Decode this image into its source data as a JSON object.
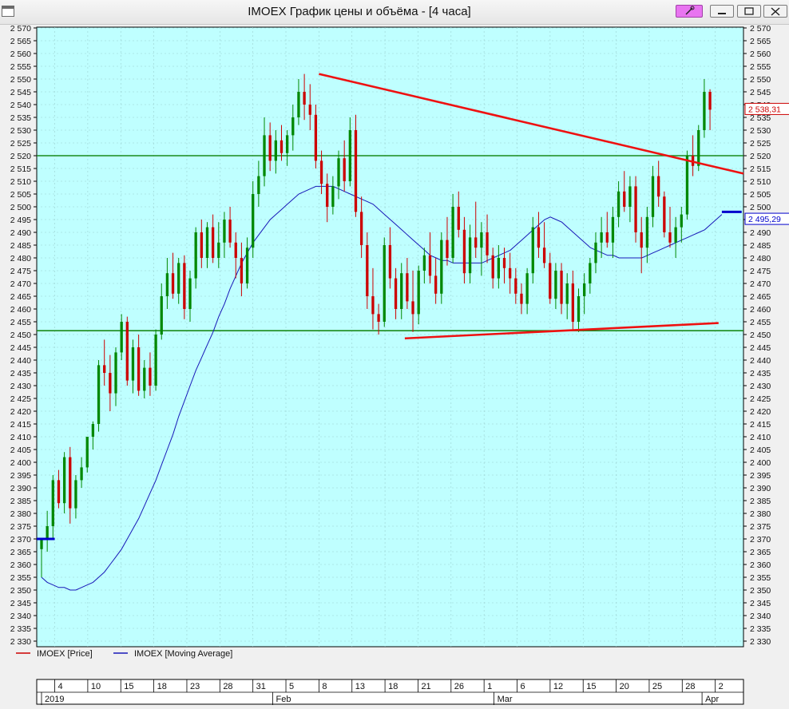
{
  "window": {
    "title": "IMOEX График цены и объёма - [4 часа]",
    "pin_icon": "pin-icon",
    "min_icon": "minimize-icon",
    "max_icon": "maximize-icon",
    "close_icon": "close-icon"
  },
  "legend": {
    "price": "IMOEX [Price]",
    "ma": "IMOEX [Moving Average]"
  },
  "colors": {
    "plot_bg": "#bfffff",
    "bull": "#008800",
    "bear": "#cc0000",
    "ma": "#1818b8",
    "hline": "#1a8a1a",
    "trend": "#ee1111",
    "blue_marker": "#0000cc"
  },
  "chart_data": {
    "type": "candlestick",
    "ylim": [
      2330,
      2572
    ],
    "y_ticks": [
      "2 570",
      "2 565",
      "2 560",
      "2 555",
      "2 550",
      "2 545",
      "2 540",
      "2 535",
      "2 530",
      "2 525",
      "2 520",
      "2 515",
      "2 510",
      "2 505",
      "2 500",
      "2 495",
      "2 490",
      "2 485",
      "2 480",
      "2 475",
      "2 470",
      "2 465",
      "2 460",
      "2 455",
      "2 450",
      "2 445",
      "2 440",
      "2 435",
      "2 430",
      "2 425",
      "2 420",
      "2 415",
      "2 410",
      "2 405",
      "2 400",
      "2 395",
      "2 390",
      "2 385",
      "2 380",
      "2 375",
      "2 370",
      "2 365",
      "2 360",
      "2 355",
      "2 350",
      "2 345",
      "2 340",
      "2 335",
      "2 330"
    ],
    "x_day_labels": [
      "4",
      "10",
      "15",
      "18",
      "23",
      "28",
      "31",
      "5",
      "8",
      "13",
      "18",
      "21",
      "26",
      "1",
      "6",
      "12",
      "15",
      "20",
      "25",
      "28",
      "2"
    ],
    "x_month_labels": [
      "2019",
      "Feb",
      "Mar",
      "Apr"
    ],
    "x_month_tick_idx": [
      0,
      70,
      137,
      200
    ],
    "x_day_tick_idx": [
      4,
      14,
      24,
      34,
      44,
      54,
      64,
      74,
      84,
      94,
      104,
      114,
      124,
      134,
      144,
      154,
      164,
      174,
      184,
      194,
      204
    ],
    "candles": [
      [
        2366,
        2370,
        2355,
        2370
      ],
      [
        2370,
        2381,
        2365,
        2375
      ],
      [
        2375,
        2395,
        2370,
        2393
      ],
      [
        2393,
        2397,
        2382,
        2384
      ],
      [
        2384,
        2404,
        2380,
        2402
      ],
      [
        2402,
        2406,
        2376,
        2382
      ],
      [
        2382,
        2395,
        2378,
        2393
      ],
      [
        2393,
        2402,
        2390,
        2398
      ],
      [
        2398,
        2410,
        2396,
        2410
      ],
      [
        2410,
        2416,
        2405,
        2415
      ],
      [
        2415,
        2440,
        2412,
        2438
      ],
      [
        2438,
        2448,
        2430,
        2435
      ],
      [
        2435,
        2442,
        2420,
        2427
      ],
      [
        2427,
        2445,
        2422,
        2443
      ],
      [
        2443,
        2458,
        2440,
        2455
      ],
      [
        2455,
        2457,
        2430,
        2432
      ],
      [
        2432,
        2448,
        2427,
        2445
      ],
      [
        2445,
        2450,
        2426,
        2428
      ],
      [
        2428,
        2440,
        2425,
        2437
      ],
      [
        2437,
        2443,
        2426,
        2430
      ],
      [
        2430,
        2452,
        2428,
        2450
      ],
      [
        2450,
        2470,
        2448,
        2465
      ],
      [
        2465,
        2480,
        2460,
        2474
      ],
      [
        2474,
        2482,
        2464,
        2466
      ],
      [
        2466,
        2480,
        2462,
        2478
      ],
      [
        2478,
        2481,
        2456,
        2460
      ],
      [
        2460,
        2475,
        2455,
        2472
      ],
      [
        2472,
        2492,
        2468,
        2490
      ],
      [
        2490,
        2495,
        2476,
        2480
      ],
      [
        2480,
        2494,
        2476,
        2492
      ],
      [
        2492,
        2497,
        2478,
        2480
      ],
      [
        2480,
        2494,
        2476,
        2486
      ],
      [
        2486,
        2498,
        2480,
        2495
      ],
      [
        2495,
        2500,
        2484,
        2486
      ],
      [
        2486,
        2490,
        2472,
        2480
      ],
      [
        2480,
        2486,
        2465,
        2470
      ],
      [
        2470,
        2488,
        2468,
        2484
      ],
      [
        2484,
        2510,
        2480,
        2505
      ],
      [
        2505,
        2518,
        2500,
        2512
      ],
      [
        2512,
        2535,
        2508,
        2528
      ],
      [
        2528,
        2533,
        2514,
        2518
      ],
      [
        2518,
        2530,
        2513,
        2526
      ],
      [
        2526,
        2532,
        2518,
        2521
      ],
      [
        2521,
        2530,
        2516,
        2528
      ],
      [
        2528,
        2540,
        2522,
        2535
      ],
      [
        2535,
        2550,
        2532,
        2545
      ],
      [
        2545,
        2552,
        2534,
        2540
      ],
      [
        2540,
        2548,
        2530,
        2536
      ],
      [
        2536,
        2540,
        2515,
        2518
      ],
      [
        2518,
        2522,
        2505,
        2509
      ],
      [
        2509,
        2513,
        2494,
        2500
      ],
      [
        2500,
        2512,
        2497,
        2508
      ],
      [
        2508,
        2522,
        2503,
        2519
      ],
      [
        2519,
        2526,
        2506,
        2510
      ],
      [
        2510,
        2535,
        2508,
        2530
      ],
      [
        2530,
        2536,
        2496,
        2498
      ],
      [
        2498,
        2504,
        2480,
        2485
      ],
      [
        2485,
        2490,
        2460,
        2465
      ],
      [
        2465,
        2476,
        2452,
        2458
      ],
      [
        2458,
        2462,
        2450,
        2455
      ],
      [
        2455,
        2488,
        2453,
        2485
      ],
      [
        2485,
        2492,
        2468,
        2472
      ],
      [
        2472,
        2476,
        2456,
        2460
      ],
      [
        2460,
        2478,
        2456,
        2474
      ],
      [
        2474,
        2480,
        2460,
        2463
      ],
      [
        2463,
        2475,
        2451,
        2458
      ],
      [
        2458,
        2477,
        2454,
        2475
      ],
      [
        2475,
        2484,
        2470,
        2481
      ],
      [
        2481,
        2490,
        2470,
        2473
      ],
      [
        2473,
        2480,
        2462,
        2466
      ],
      [
        2466,
        2490,
        2462,
        2487
      ],
      [
        2487,
        2496,
        2477,
        2480
      ],
      [
        2480,
        2505,
        2478,
        2500
      ],
      [
        2500,
        2506,
        2488,
        2491
      ],
      [
        2491,
        2496,
        2470,
        2474
      ],
      [
        2474,
        2493,
        2470,
        2488
      ],
      [
        2488,
        2502,
        2480,
        2484
      ],
      [
        2484,
        2494,
        2473,
        2490
      ],
      [
        2490,
        2497,
        2478,
        2481
      ],
      [
        2481,
        2484,
        2468,
        2472
      ],
      [
        2472,
        2485,
        2468,
        2480
      ],
      [
        2480,
        2484,
        2470,
        2476
      ],
      [
        2476,
        2482,
        2466,
        2472
      ],
      [
        2472,
        2476,
        2462,
        2466
      ],
      [
        2466,
        2470,
        2458,
        2462
      ],
      [
        2462,
        2476,
        2458,
        2474
      ],
      [
        2474,
        2496,
        2470,
        2492
      ],
      [
        2492,
        2498,
        2480,
        2484
      ],
      [
        2484,
        2494,
        2476,
        2478
      ],
      [
        2478,
        2482,
        2462,
        2464
      ],
      [
        2464,
        2478,
        2460,
        2475
      ],
      [
        2475,
        2478,
        2458,
        2462
      ],
      [
        2462,
        2474,
        2456,
        2470
      ],
      [
        2470,
        2475,
        2452,
        2455
      ],
      [
        2455,
        2468,
        2451,
        2465
      ],
      [
        2465,
        2474,
        2458,
        2470
      ],
      [
        2470,
        2480,
        2466,
        2478
      ],
      [
        2478,
        2490,
        2474,
        2486
      ],
      [
        2486,
        2496,
        2480,
        2490
      ],
      [
        2490,
        2498,
        2484,
        2486
      ],
      [
        2486,
        2500,
        2480,
        2496
      ],
      [
        2496,
        2510,
        2492,
        2506
      ],
      [
        2506,
        2514,
        2498,
        2500
      ],
      [
        2500,
        2512,
        2494,
        2508
      ],
      [
        2508,
        2512,
        2486,
        2490
      ],
      [
        2490,
        2496,
        2474,
        2484
      ],
      [
        2484,
        2500,
        2478,
        2496
      ],
      [
        2496,
        2516,
        2492,
        2512
      ],
      [
        2512,
        2518,
        2500,
        2504
      ],
      [
        2504,
        2506,
        2488,
        2490
      ],
      [
        2490,
        2500,
        2484,
        2486
      ],
      [
        2486,
        2496,
        2480,
        2492
      ],
      [
        2492,
        2500,
        2486,
        2497
      ],
      [
        2497,
        2522,
        2495,
        2520
      ],
      [
        2520,
        2528,
        2512,
        2516
      ],
      [
        2516,
        2532,
        2514,
        2530
      ],
      [
        2530,
        2550,
        2527,
        2545
      ],
      [
        2545,
        2546,
        2530,
        2538
      ]
    ],
    "moving_average": [
      2355,
      2353,
      2352,
      2351,
      2351,
      2350,
      2350,
      2351,
      2352,
      2353,
      2355,
      2357,
      2360,
      2363,
      2366,
      2370,
      2374,
      2378,
      2383,
      2388,
      2393,
      2399,
      2405,
      2411,
      2418,
      2424,
      2430,
      2436,
      2441,
      2446,
      2451,
      2457,
      2462,
      2468,
      2473,
      2478,
      2482,
      2486,
      2489,
      2492,
      2495,
      2497,
      2499,
      2501,
      2503,
      2505,
      2506,
      2507,
      2508,
      2508,
      2508,
      2508,
      2507,
      2506,
      2505,
      2504,
      2503,
      2502,
      2501,
      2499,
      2497,
      2495,
      2493,
      2491,
      2489,
      2487,
      2485,
      2483,
      2481,
      2480,
      2479,
      2479,
      2478,
      2478,
      2478,
      2478,
      2478,
      2478,
      2479,
      2480,
      2481,
      2482,
      2483,
      2485,
      2487,
      2489,
      2491,
      2493,
      2495,
      2496,
      2495,
      2494,
      2492,
      2490,
      2488,
      2486,
      2484,
      2483,
      2482,
      2481,
      2481,
      2480,
      2480,
      2480,
      2480,
      2480,
      2481,
      2482,
      2483,
      2484,
      2485,
      2486,
      2487,
      2488,
      2489,
      2490,
      2491,
      2493,
      2495,
      2497
    ],
    "ma_map": "ma index 0..119 spans candle index 0..206",
    "horizontal_lines": [
      2520,
      2451.5
    ],
    "trendlines": [
      {
        "from": [
          84,
          2552
        ],
        "to": [
          215,
          2513
        ]
      },
      {
        "from": [
          110,
          2448.5
        ],
        "to": [
          205,
          2454.5
        ]
      }
    ],
    "blue_markers": [
      {
        "from": [
          -3,
          2370
        ],
        "to": [
          4,
          2370
        ]
      },
      {
        "from": [
          206,
          2498
        ],
        "to": [
          212,
          2498
        ]
      }
    ],
    "price_tags": [
      {
        "value": 2538.31,
        "label": "2 538,31",
        "color": "#cc0000"
      },
      {
        "value": 2495.29,
        "label": "2 495,29",
        "color": "#0000cc"
      }
    ],
    "n_slots": 214
  }
}
